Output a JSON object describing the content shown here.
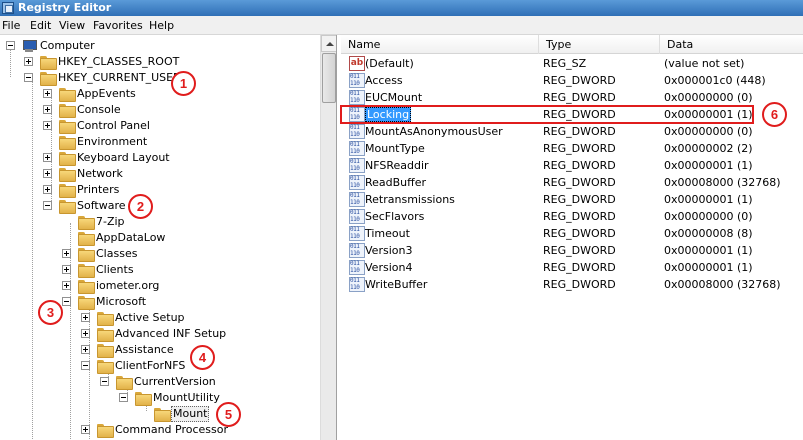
{
  "window": {
    "title": "Registry Editor"
  },
  "menu": [
    "File",
    "Edit",
    "View",
    "Favorites",
    "Help"
  ],
  "tree": [
    {
      "label": "Computer",
      "icon": "computer-icon"
    },
    {
      "label": "HKEY_CLASSES_ROOT"
    },
    {
      "label": "HKEY_CURRENT_USER"
    },
    {
      "label": "AppEvents"
    },
    {
      "label": "Console"
    },
    {
      "label": "Control Panel"
    },
    {
      "label": "Environment"
    },
    {
      "label": "Keyboard Layout"
    },
    {
      "label": "Network"
    },
    {
      "label": "Printers"
    },
    {
      "label": "Software"
    },
    {
      "label": "7-Zip"
    },
    {
      "label": "AppDataLow"
    },
    {
      "label": "Classes"
    },
    {
      "label": "Clients"
    },
    {
      "label": "iometer.org"
    },
    {
      "label": "Microsoft"
    },
    {
      "label": "Active Setup"
    },
    {
      "label": "Advanced INF Setup"
    },
    {
      "label": "Assistance"
    },
    {
      "label": "ClientForNFS"
    },
    {
      "label": "CurrentVersion"
    },
    {
      "label": "MountUtility"
    },
    {
      "label": "Mount"
    },
    {
      "label": "Command Processor"
    }
  ],
  "columns": {
    "name": "Name",
    "type": "Type",
    "data": "Data"
  },
  "values": [
    {
      "name": "(Default)",
      "type": "REG_SZ",
      "data": "(value not set)",
      "icon": "string-value-icon"
    },
    {
      "name": "Access",
      "type": "REG_DWORD",
      "data": "0x000001c0 (448)",
      "icon": "binary-value-icon"
    },
    {
      "name": "EUCMount",
      "type": "REG_DWORD",
      "data": "0x00000000 (0)",
      "icon": "binary-value-icon"
    },
    {
      "name": "Locking",
      "type": "REG_DWORD",
      "data": "0x00000001 (1)",
      "icon": "binary-value-icon",
      "selected": true
    },
    {
      "name": "MountAsAnonymousUser",
      "type": "REG_DWORD",
      "data": "0x00000000 (0)",
      "icon": "binary-value-icon"
    },
    {
      "name": "MountType",
      "type": "REG_DWORD",
      "data": "0x00000002 (2)",
      "icon": "binary-value-icon"
    },
    {
      "name": "NFSReaddir",
      "type": "REG_DWORD",
      "data": "0x00000001 (1)",
      "icon": "binary-value-icon"
    },
    {
      "name": "ReadBuffer",
      "type": "REG_DWORD",
      "data": "0x00008000 (32768)",
      "icon": "binary-value-icon"
    },
    {
      "name": "Retransmissions",
      "type": "REG_DWORD",
      "data": "0x00000001 (1)",
      "icon": "binary-value-icon"
    },
    {
      "name": "SecFlavors",
      "type": "REG_DWORD",
      "data": "0x00000000 (0)",
      "icon": "binary-value-icon"
    },
    {
      "name": "Timeout",
      "type": "REG_DWORD",
      "data": "0x00000008 (8)",
      "icon": "binary-value-icon"
    },
    {
      "name": "Version3",
      "type": "REG_DWORD",
      "data": "0x00000001 (1)",
      "icon": "binary-value-icon"
    },
    {
      "name": "Version4",
      "type": "REG_DWORD",
      "data": "0x00000001 (1)",
      "icon": "binary-value-icon"
    },
    {
      "name": "WriteBuffer",
      "type": "REG_DWORD",
      "data": "0x00008000 (32768)",
      "icon": "binary-value-icon"
    }
  ],
  "callouts": [
    "1",
    "2",
    "3",
    "4",
    "5",
    "6"
  ],
  "colors": {
    "callout": "#e01c1c",
    "selection": "#3399ff"
  }
}
